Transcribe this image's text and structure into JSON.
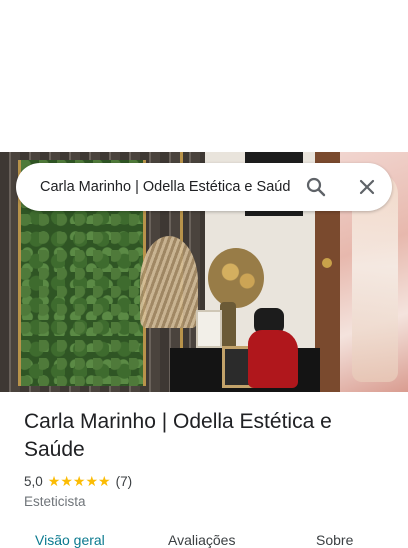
{
  "search": {
    "query": "Carla Marinho | Odella Estética e Saúde",
    "search_icon": "search-icon",
    "close_icon": "close-icon"
  },
  "place": {
    "title": "Carla Marinho | Odella Estética e Saúde",
    "rating": "5,0",
    "stars": 5,
    "review_count": "(7)",
    "category": "Esteticista"
  },
  "tabs": [
    {
      "label": "Visão geral",
      "active": true
    },
    {
      "label": "Avaliações",
      "active": false
    },
    {
      "label": "Sobre",
      "active": false
    }
  ],
  "colors": {
    "accent": "#0b7a8f",
    "star": "#fbbc04",
    "text_primary": "#202124",
    "text_secondary": "#70757a"
  }
}
